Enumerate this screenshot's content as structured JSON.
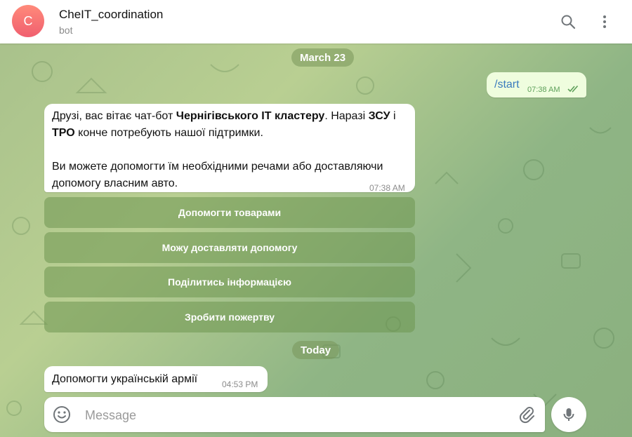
{
  "chat": {
    "avatar_letter": "C",
    "title": "CheIT_coordination",
    "subtitle": "bot"
  },
  "icons": {
    "search": "search-icon",
    "more": "more-vertical-icon",
    "emoji": "smile-icon",
    "attach": "paperclip-icon",
    "mic": "microphone-icon",
    "read": "double-check-icon"
  },
  "colors": {
    "accent": "#3a7bbd",
    "outgoing_bubble": "#effdde",
    "avatar": "#f05f6f",
    "read_check": "#5ea05a"
  },
  "dates": {
    "first": "March 23",
    "second": "Today"
  },
  "outgoing": {
    "text": "/start",
    "time": "07:38 AM"
  },
  "message1": {
    "p1_a": "Друзі, вас вітає чат-бот ",
    "p1_b": "Чернігівського IT кластеру",
    "p1_c": ". Наразі ",
    "p1_d": "ЗСУ",
    "p1_e": " і ",
    "p1_f": "ТРО",
    "p1_g": " конче потребують нашої підтримки.",
    "p2": "Ви можете допомогти їм необхідними речами або доставляючи допомогу власним авто.",
    "time": "07:38 AM"
  },
  "keyboard": [
    {
      "label": "Допомогти товарами"
    },
    {
      "label": "Можу доставляти допомогу"
    },
    {
      "label": "Поділитись інформацією"
    },
    {
      "label": "Зробити пожертву"
    }
  ],
  "message2": {
    "text": "Допомогти українській армії",
    "time": "04:53 PM"
  },
  "composer": {
    "placeholder": "Message"
  }
}
